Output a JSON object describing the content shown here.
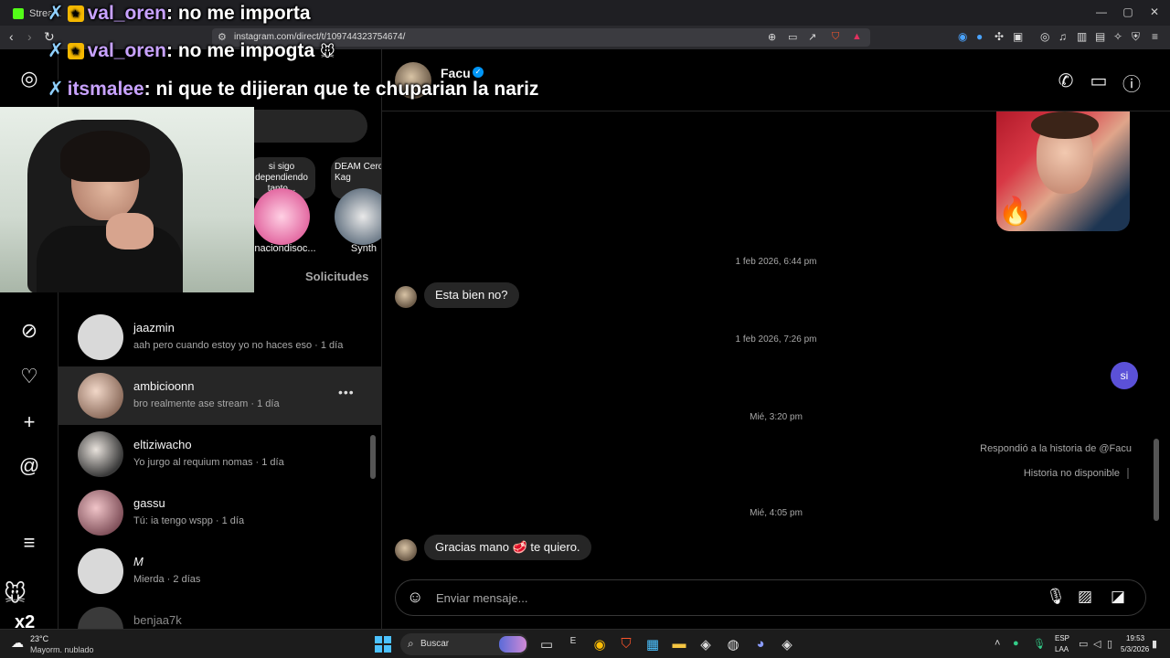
{
  "browser": {
    "tab_title": "Strea...",
    "url": "instagram.com/direct/t/109744323754674/",
    "window_controls": [
      "—",
      "▢",
      "✕"
    ]
  },
  "overlay_chat": [
    {
      "user": "val_oren",
      "text": ": no me importa"
    },
    {
      "user": "val_oren",
      "text": ": no me impogta"
    },
    {
      "user": "itsmalee",
      "text": ": ni que te dijieran que te chuparian la nariz"
    }
  ],
  "leftnav": {
    "icons": [
      "instagram-icon",
      "explore-icon",
      "heart-icon",
      "plus-icon",
      "threads-icon",
      "menu-icon"
    ]
  },
  "notes": [
    {
      "text": "si sigo dependiendo tanto...",
      "name": "cinaciondisoc..."
    },
    {
      "text": "DEAM Cero°, Kag",
      "name": "Synth"
    }
  ],
  "solicitudes": "Solicitudes",
  "conversations": [
    {
      "name": "jaazmin",
      "preview": "aah pero cuando estoy yo no haces eso · 1 día",
      "active": false
    },
    {
      "name": "ambicioonn",
      "preview": "bro realmente ase stream · 1 día",
      "active": true
    },
    {
      "name": "eltiziwacho",
      "preview": "Yo jurgo al requium nomas · 1 día",
      "active": false
    },
    {
      "name": "gassu",
      "preview": "Tú: ia tengo wspp · 1 día",
      "active": false
    },
    {
      "name": "M",
      "preview": "Mierda · 2 días",
      "active": false
    },
    {
      "name": "benjaa7k",
      "preview": "",
      "active": false
    }
  ],
  "chat": {
    "contact_name": "Facu",
    "timestamps": [
      "1 feb 2026, 6:44 pm",
      "1 feb 2026, 7:26 pm",
      "Mié, 3:20 pm",
      "Mié, 4:05 pm"
    ],
    "msg_in_1": "Esta bien no?",
    "msg_out_1": "si",
    "story_reply": "Respondió a la historia de @Facu",
    "story_unavailable": "Historia no disponible",
    "msg_in_2": "Gracias mano 🥩 te quiero.",
    "composer_placeholder": "Enviar mensaje..."
  },
  "taskbar": {
    "temp": "23°C",
    "weather": "Mayorm. nublado",
    "search_label": "Buscar",
    "lang": "ESP",
    "lang2": "LAA",
    "time": "19:53",
    "date": "5/3/2026"
  },
  "stream": {
    "multiplier": "x2"
  }
}
